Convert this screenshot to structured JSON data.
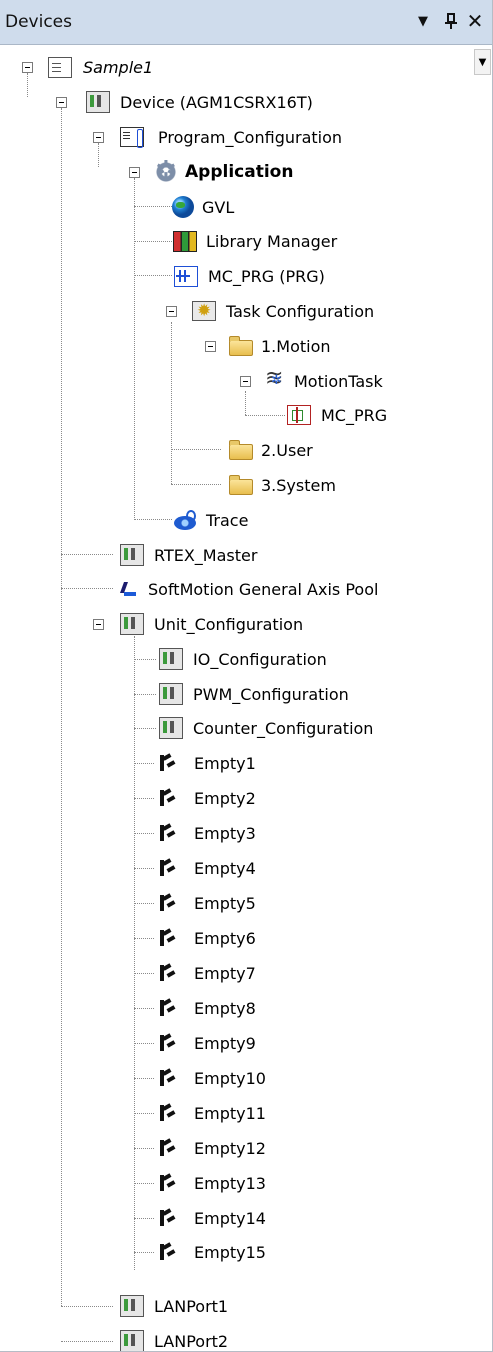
{
  "panel": {
    "title": "Devices",
    "dropdown_glyph": "▼",
    "pin_glyph": "ᵖ",
    "close_glyph": "✕",
    "combo_glyph": "▼"
  },
  "tree": {
    "root": "Sample1",
    "device": "Device (AGM1CSRX16T)",
    "program_configuration": "Program_Configuration",
    "application": "Application",
    "gvl": "GVL",
    "library_manager": "Library Manager",
    "mc_prg_prg": "MC_PRG (PRG)",
    "task_configuration": "Task Configuration",
    "folder_motion": "1.Motion",
    "motion_task": "MotionTask",
    "mc_prg": "MC_PRG",
    "folder_user": "2.User",
    "folder_system": "3.System",
    "trace": "Trace",
    "rtex_master": "RTEX_Master",
    "softmotion_pool": "SoftMotion General Axis Pool",
    "unit_configuration": "Unit_Configuration",
    "io_configuration": "IO_Configuration",
    "pwm_configuration": "PWM_Configuration",
    "counter_configuration": "Counter_Configuration",
    "empties": [
      "Empty1",
      "Empty2",
      "Empty3",
      "Empty4",
      "Empty5",
      "Empty6",
      "Empty7",
      "Empty8",
      "Empty9",
      "Empty10",
      "Empty11",
      "Empty12",
      "Empty13",
      "Empty14",
      "Empty15"
    ],
    "lan_port1": "LANPort1",
    "lan_port2": "LANPort2"
  }
}
